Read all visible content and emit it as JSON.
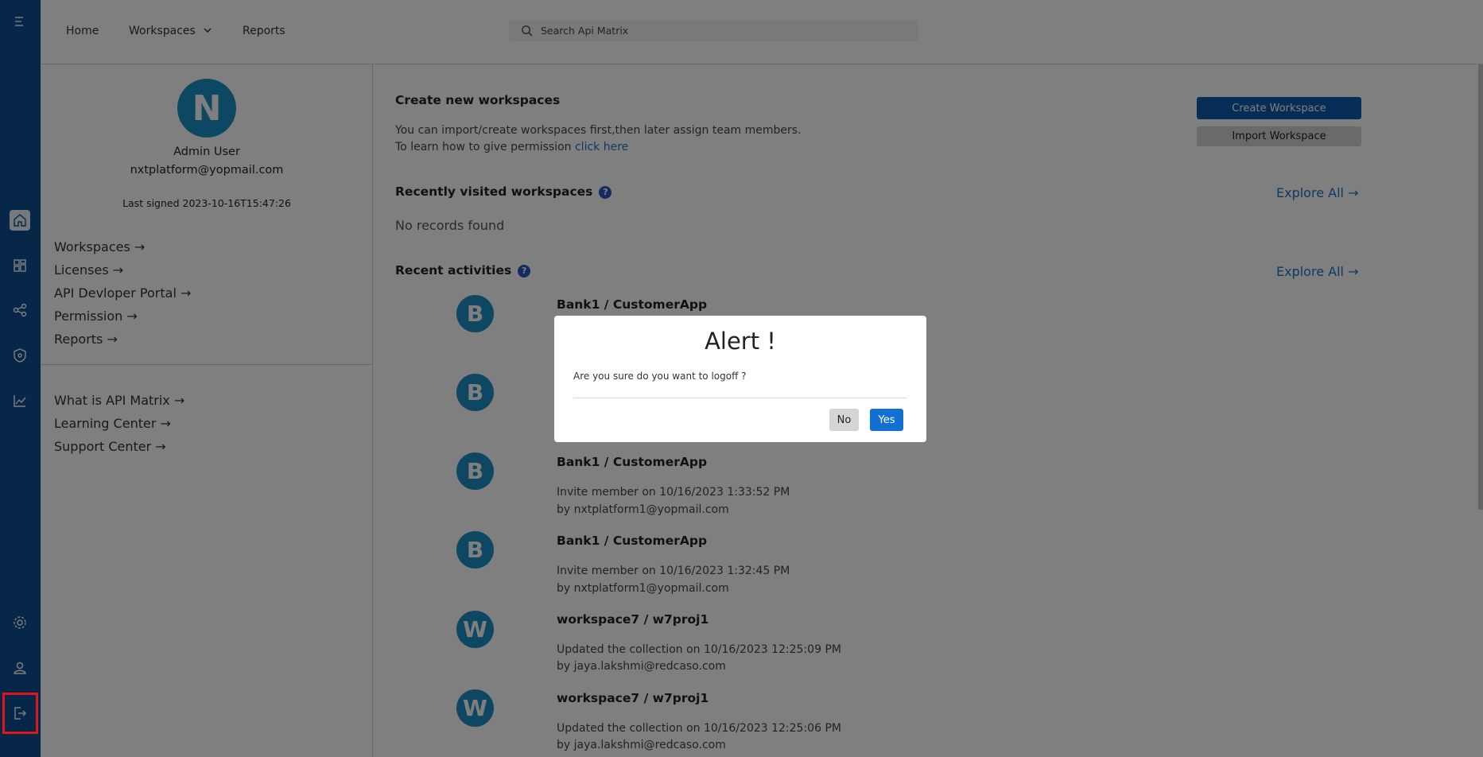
{
  "nav": {
    "home": "Home",
    "workspaces": "Workspaces",
    "reports": "Reports"
  },
  "search": {
    "placeholder": "Search Api Matrix"
  },
  "profile": {
    "avatar_letter": "N",
    "name": "Admin User",
    "email": "nxtplatform@yopmail.com",
    "last_signed": "Last signed 2023-10-16T15:47:26",
    "links": [
      "Workspaces",
      "Licenses",
      "API Devloper Portal",
      "Permission",
      "Reports"
    ],
    "help_links": [
      "What is API Matrix",
      "Learning Center",
      "Support Center"
    ]
  },
  "create": {
    "heading": "Create new workspaces",
    "line1": "You can import/create workspaces first,then later assign team members.",
    "line2_prefix": "To learn how to give permission",
    "line2_link": "click here",
    "create_button": "Create Workspace",
    "import_button": "Import Workspace"
  },
  "recent_visited": {
    "heading": "Recently visited workspaces",
    "empty": "No records found",
    "explore": "Explore All"
  },
  "recent_activities": {
    "heading": "Recent activities",
    "explore": "Explore All",
    "items": [
      {
        "letter": "B",
        "title": "Bank1 / CustomerApp",
        "line1": "",
        "line2": ""
      },
      {
        "letter": "B",
        "title": "",
        "line1": "",
        "line2": ""
      },
      {
        "letter": "B",
        "title": "Bank1 / CustomerApp",
        "line1": "Invite member on 10/16/2023 1:33:52 PM",
        "line2": "by nxtplatform1@yopmail.com"
      },
      {
        "letter": "B",
        "title": "Bank1 / CustomerApp",
        "line1": "Invite member on 10/16/2023 1:32:45 PM",
        "line2": "by nxtplatform1@yopmail.com"
      },
      {
        "letter": "W",
        "title": "workspace7 / w7proj1",
        "line1": "Updated the collection on 10/16/2023 12:25:09 PM",
        "line2": "by jaya.lakshmi@redcaso.com"
      },
      {
        "letter": "W",
        "title": "workspace7 / w7proj1",
        "line1": "Updated the collection on 10/16/2023 12:25:06 PM",
        "line2": "by jaya.lakshmi@redcaso.com"
      }
    ]
  },
  "modal": {
    "title": "Alert !",
    "message": "Are you sure do you want to logoff ?",
    "no": "No",
    "yes": "Yes"
  },
  "colors": {
    "rail": "#0d4f8f",
    "primary": "#1170d0",
    "avatar": "#1d8fc4",
    "highlight": "#e3131b"
  }
}
